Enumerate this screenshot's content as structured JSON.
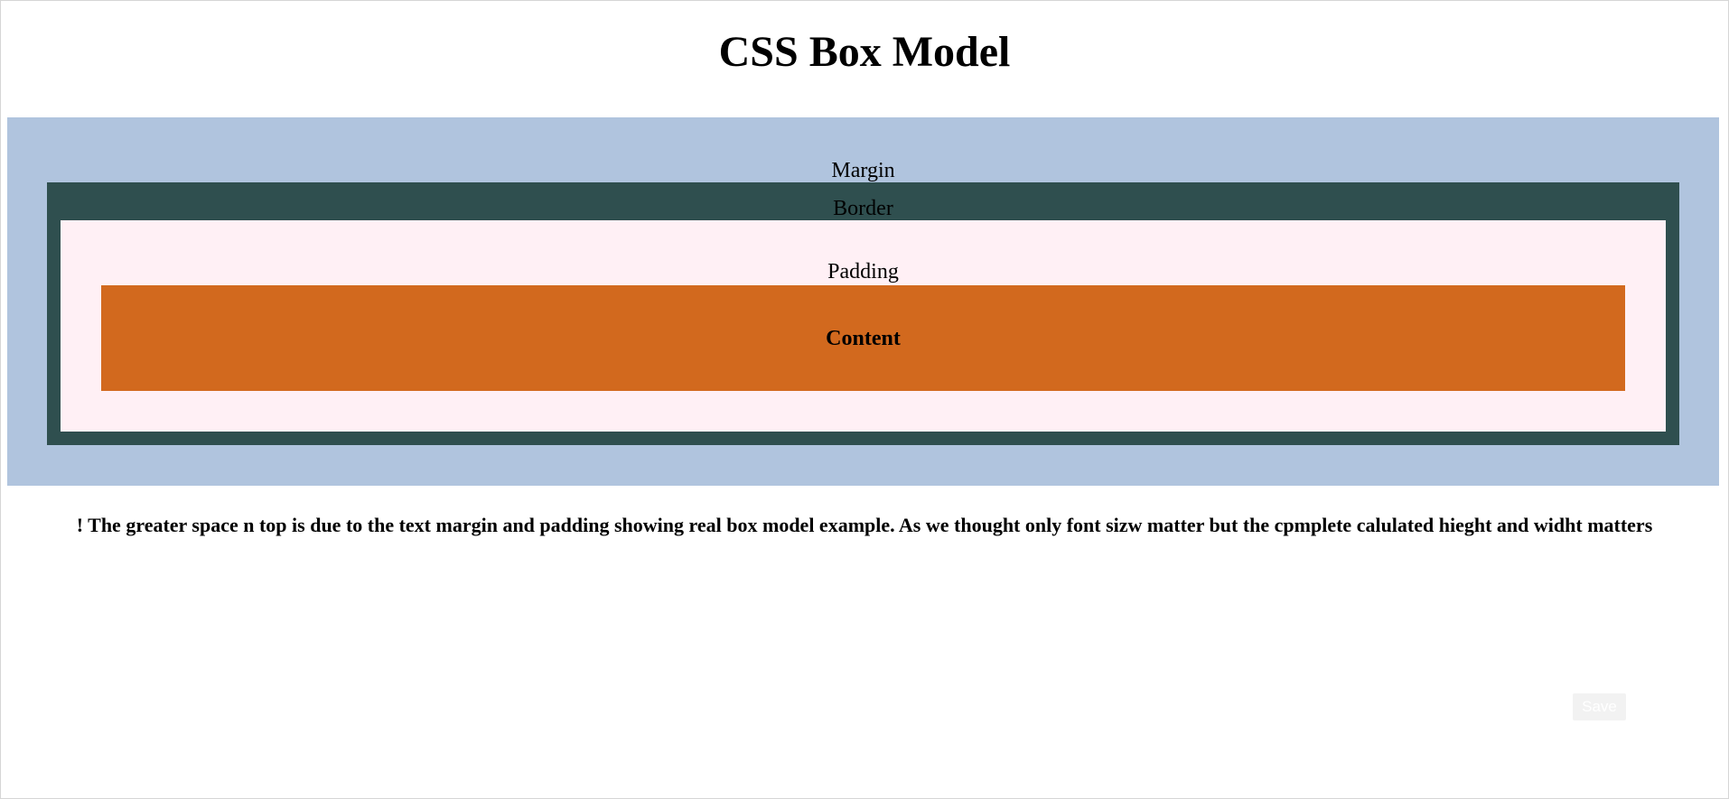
{
  "page": {
    "title": "CSS Box Model",
    "note": "! The greater space n top is due to the text margin and padding showing real box model example. As we thought only font sizw matter but the cpmplete calulated hieght and widht matters"
  },
  "box_model": {
    "margin_label": "Margin",
    "border_label": "Border",
    "padding_label": "Padding",
    "content_label": "Content"
  },
  "actions": {
    "save_label": "Save"
  },
  "colors": {
    "margin": "#b0c4de",
    "border": "#2f4f4f",
    "padding": "#fff0f5",
    "content": "#d2691e"
  }
}
